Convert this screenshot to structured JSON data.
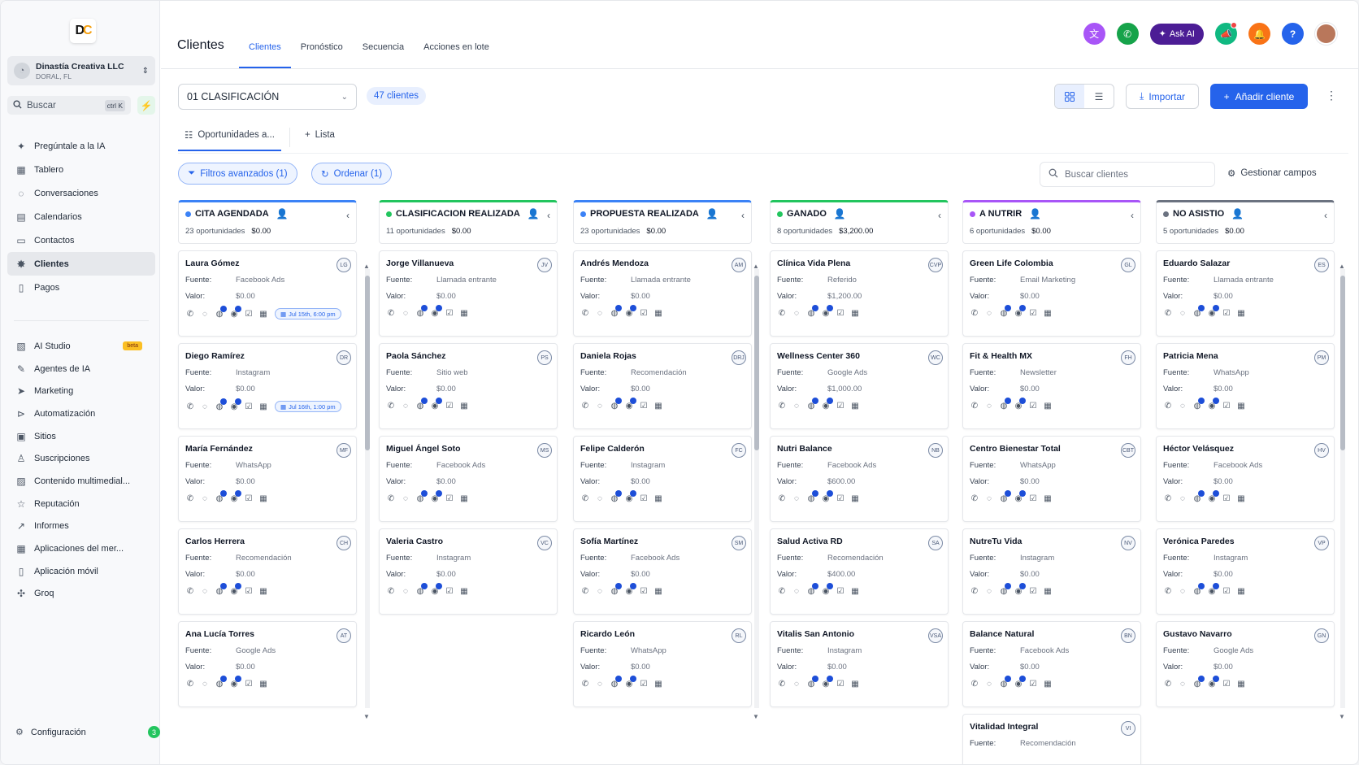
{
  "sidebar": {
    "account": {
      "name": "Dinastía Creativa LLC",
      "location": "DORAL, FL"
    },
    "search": {
      "label": "Buscar",
      "shortcut": "ctrl K"
    },
    "nav": [
      {
        "label": "Pregúntale a la IA",
        "icon": "sparkle-icon",
        "active": false
      },
      {
        "label": "Tablero",
        "icon": "dashboard-icon",
        "active": false
      },
      {
        "label": "Conversaciones",
        "icon": "chat-icon",
        "active": false
      },
      {
        "label": "Calendarios",
        "icon": "calendar-icon",
        "active": false
      },
      {
        "label": "Contactos",
        "icon": "contacts-icon",
        "active": false
      },
      {
        "label": "Clientes",
        "icon": "clients-icon",
        "active": true
      },
      {
        "label": "Pagos",
        "icon": "payments-icon",
        "active": false
      }
    ],
    "nav2": [
      {
        "label": "AI Studio",
        "icon": "ai-studio-icon",
        "badge": "beta"
      },
      {
        "label": "Agentes de IA",
        "icon": "agents-icon"
      },
      {
        "label": "Marketing",
        "icon": "send-icon"
      },
      {
        "label": "Automatización",
        "icon": "automation-icon"
      },
      {
        "label": "Sitios",
        "icon": "sites-icon"
      },
      {
        "label": "Suscripciones",
        "icon": "subscriptions-icon"
      },
      {
        "label": "Contenido multimedial...",
        "icon": "media-icon"
      },
      {
        "label": "Reputación",
        "icon": "star-icon"
      },
      {
        "label": "Informes",
        "icon": "reports-icon"
      },
      {
        "label": "Aplicaciones del mer...",
        "icon": "apps-icon"
      },
      {
        "label": "Aplicación móvil",
        "icon": "mobile-icon"
      },
      {
        "label": "Groq",
        "icon": "groq-icon"
      }
    ],
    "config": {
      "label": "Configuración",
      "badge": "3"
    }
  },
  "header": {
    "title": "Clientes",
    "tabs": [
      "Clientes",
      "Pronóstico",
      "Secuencia",
      "Acciones en lote"
    ],
    "ask_ai": "Ask AI"
  },
  "toolbar": {
    "pipeline": "01 CLASIFICACIÓN",
    "count": "47 clientes",
    "import": "Importar",
    "add": "Añadir cliente",
    "subtabs": [
      "Oportunidades a...",
      "Lista"
    ],
    "filters": "Filtros avanzados (1)",
    "sort": "Ordenar (1)",
    "search_placeholder": "Buscar clientes",
    "manage_fields": "Gestionar campos"
  },
  "labels": {
    "fuente": "Fuente:",
    "valor": "Valor:"
  },
  "columns": [
    {
      "title": "CITA AGENDADA",
      "color": "#3b82f6",
      "opps": "23 oportunidades",
      "total": "$0.00",
      "cards": [
        {
          "name": "Laura Gómez",
          "initials": "LG",
          "source": "Facebook Ads",
          "value": "$0.00",
          "date": "Jul 15th, 6:00 pm"
        },
        {
          "name": "Diego Ramírez",
          "initials": "DR",
          "source": "Instagram",
          "value": "$0.00",
          "date": "Jul 16th, 1:00 pm"
        },
        {
          "name": "María Fernández",
          "initials": "MF",
          "source": "WhatsApp",
          "value": "$0.00"
        },
        {
          "name": "Carlos Herrera",
          "initials": "CH",
          "source": "Recomendación",
          "value": "$0.00"
        },
        {
          "name": "Ana Lucía Torres",
          "initials": "AT",
          "source": "Google Ads",
          "value": "$0.00"
        }
      ]
    },
    {
      "title": "CLASIFICACION REALIZADA",
      "color": "#22c55e",
      "opps": "11 oportunidades",
      "total": "$0.00",
      "cards": [
        {
          "name": "Jorge Villanueva",
          "initials": "JV",
          "source": "Llamada entrante",
          "value": "$0.00"
        },
        {
          "name": "Paola Sánchez",
          "initials": "PS",
          "source": "Sitio web",
          "value": "$0.00"
        },
        {
          "name": "Miguel Ángel Soto",
          "initials": "MS",
          "source": "Facebook Ads",
          "value": "$0.00"
        },
        {
          "name": "Valeria Castro",
          "initials": "VC",
          "source": "Instagram",
          "value": "$0.00"
        }
      ]
    },
    {
      "title": "PROPUESTA REALIZADA",
      "color": "#3b82f6",
      "opps": "23 oportunidades",
      "total": "$0.00",
      "cards": [
        {
          "name": "Andrés Mendoza",
          "initials": "AM",
          "source": "Llamada entrante",
          "value": "$0.00"
        },
        {
          "name": "Daniela Rojas",
          "initials": "DRJ",
          "source": "Recomendación",
          "value": "$0.00"
        },
        {
          "name": "Felipe Calderón",
          "initials": "FC",
          "source": "Instagram",
          "value": "$0.00"
        },
        {
          "name": "Sofía Martínez",
          "initials": "SM",
          "source": "Facebook Ads",
          "value": "$0.00"
        },
        {
          "name": "Ricardo León",
          "initials": "RL",
          "source": "WhatsApp",
          "value": "$0.00"
        }
      ]
    },
    {
      "title": "GANADO",
      "color": "#22c55e",
      "opps": "8 oportunidades",
      "total": "$3,200.00",
      "cards": [
        {
          "name": "Clínica Vida Plena",
          "initials": "CVP",
          "source": "Referido",
          "value": "$1,200.00"
        },
        {
          "name": "Wellness Center 360",
          "initials": "WC",
          "source": "Google Ads",
          "value": "$1,000.00"
        },
        {
          "name": "Nutri Balance",
          "initials": "NB",
          "source": "Facebook Ads",
          "value": "$600.00"
        },
        {
          "name": "Salud Activa RD",
          "initials": "SA",
          "source": "Recomendación",
          "value": "$400.00"
        },
        {
          "name": "Vitalis San Antonio",
          "initials": "VSA",
          "source": "Instagram",
          "value": "$0.00"
        }
      ]
    },
    {
      "title": "A NUTRIR",
      "color": "#a855f7",
      "opps": "6 oportunidades",
      "total": "$0.00",
      "cards": [
        {
          "name": "Green Life Colombia",
          "initials": "GL",
          "source": "Email Marketing",
          "value": "$0.00"
        },
        {
          "name": "Fit & Health MX",
          "initials": "FH",
          "source": "Newsletter",
          "value": "$0.00"
        },
        {
          "name": "Centro Bienestar Total",
          "initials": "CBT",
          "source": "WhatsApp",
          "value": "$0.00"
        },
        {
          "name": "NutreTu Vida",
          "initials": "NV",
          "source": "Instagram",
          "value": "$0.00"
        },
        {
          "name": "Balance Natural",
          "initials": "BN",
          "source": "Facebook Ads",
          "value": "$0.00"
        },
        {
          "name": "Vitalidad Integral",
          "initials": "VI",
          "source": "Recomendación",
          "value": ""
        }
      ]
    },
    {
      "title": "NO ASISTIO",
      "color": "#6b7280",
      "opps": "5 oportunidades",
      "total": "$0.00",
      "cards": [
        {
          "name": "Eduardo Salazar",
          "initials": "ES",
          "source": "Llamada entrante",
          "value": "$0.00"
        },
        {
          "name": "Patricia Mena",
          "initials": "PM",
          "source": "WhatsApp",
          "value": "$0.00"
        },
        {
          "name": "Héctor Velásquez",
          "initials": "HV",
          "source": "Facebook Ads",
          "value": "$0.00"
        },
        {
          "name": "Verónica Paredes",
          "initials": "VP",
          "source": "Instagram",
          "value": "$0.00"
        },
        {
          "name": "Gustavo Navarro",
          "initials": "GN",
          "source": "Google Ads",
          "value": "$0.00"
        }
      ]
    }
  ]
}
